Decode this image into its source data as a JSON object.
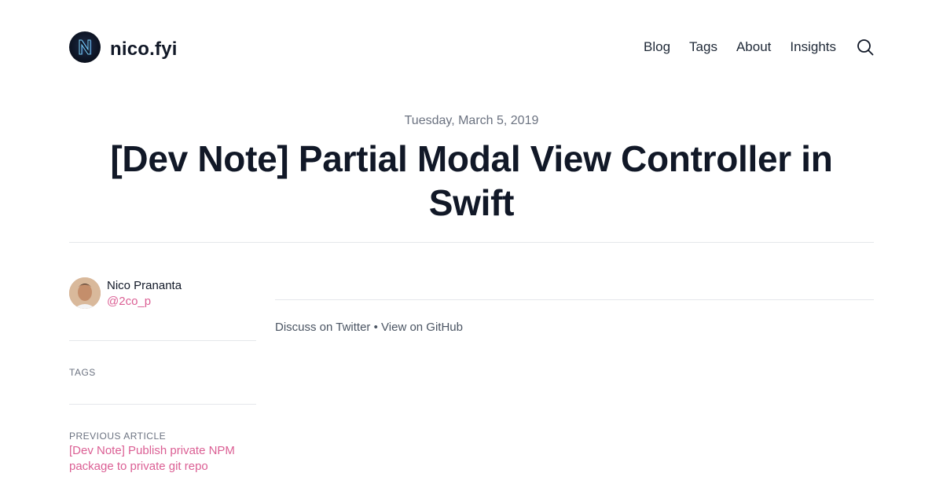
{
  "header": {
    "site_name": "nico.fyi",
    "nav": [
      "Blog",
      "Tags",
      "About",
      "Insights"
    ],
    "search_icon": "search-icon"
  },
  "post": {
    "date": "Tuesday, March 5, 2019",
    "title": "[Dev Note] Partial Modal View Controller in Swift"
  },
  "author": {
    "name": "Nico Prananta",
    "handle": "@2co_p"
  },
  "sidebar": {
    "tags_label": "TAGS",
    "previous_label": "PREVIOUS ARTICLE",
    "previous_title": "[Dev Note] Publish private NPM package to private git repo"
  },
  "content": {
    "discuss_link": "Discuss on Twitter",
    "separator": " • ",
    "github_link": "View on GitHub"
  },
  "colors": {
    "accent": "#db5f94",
    "text": "#111827",
    "muted": "#6b7280",
    "divider": "#e5e7eb"
  }
}
